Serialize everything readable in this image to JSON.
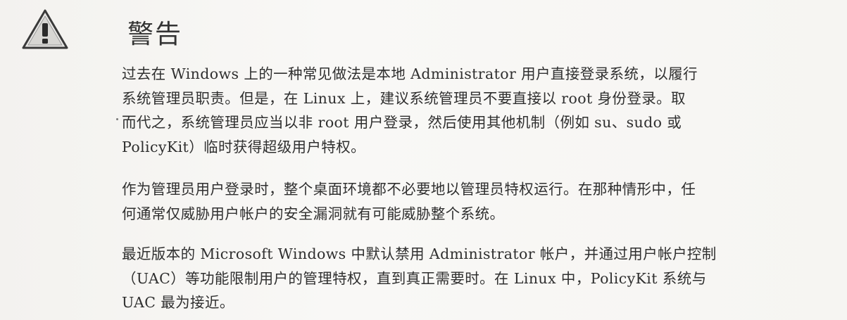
{
  "warning": {
    "icon": "warning-triangle-icon",
    "title": "警告"
  },
  "paragraphs": [
    "过去在 Windows 上的一种常见做法是本地 Administrator 用户直接登录系统，以履行\n系统管理员职责。但是，在 Linux 上，建议系统管理员不要直接以 root 身份登录。取\n而代之，系统管理员应当以非 root 用户登录，然后使用其他机制（例如 su、sudo 或\nPolicyKit）临时获得超级用户特权。",
    "作为管理员用户登录时，整个桌面环境都不必要地以管理员特权运行。在那种情形中，任\n何通常仅威胁用户帐户的安全漏洞就有可能威胁整个系统。",
    "最近版本的 Microsoft Windows 中默认禁用 Administrator 帐户，并通过用户帐户控制\n（UAC）等功能限制用户的管理特权，直到真正需要时。在 Linux 中，PolicyKit 系统与\nUAC 最为接近。"
  ]
}
